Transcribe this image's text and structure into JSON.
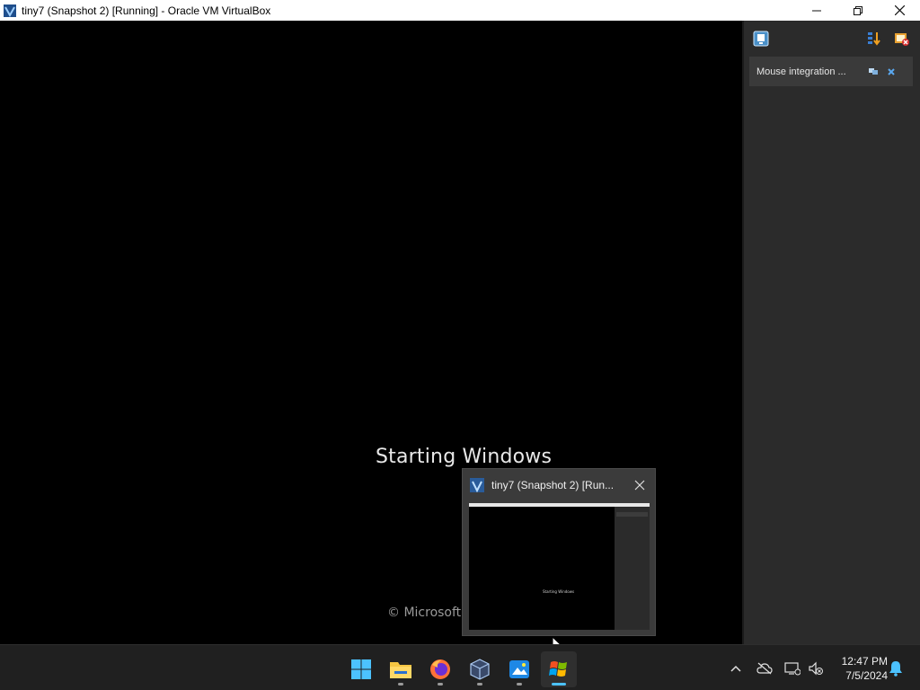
{
  "window": {
    "title": "tiny7 (Snapshot 2) [Running] - Oracle VM VirtualBox",
    "controls": [
      "minimize",
      "restore",
      "close"
    ]
  },
  "vm": {
    "boot_text": "Starting Windows",
    "copyright": "© Microsoft"
  },
  "side_panel": {
    "toolbar_icons": [
      "notification-center-icon",
      "sort-icon",
      "close-all-icon"
    ],
    "notification": {
      "text": "Mouse integration ...",
      "icons": [
        "keep-icon",
        "dismiss-icon"
      ]
    }
  },
  "taskbar_preview": {
    "title": "tiny7 (Snapshot 2) [Run...",
    "thumbnail_text": "Starting Windows"
  },
  "taskbar": {
    "apps": [
      {
        "name": "start-icon",
        "running": false
      },
      {
        "name": "file-explorer-icon",
        "running": true
      },
      {
        "name": "firefox-icon",
        "running": true
      },
      {
        "name": "virtualbox-icon",
        "running": true
      },
      {
        "name": "paint-icon",
        "running": true
      },
      {
        "name": "windows-vm-icon",
        "running": true,
        "active": true
      }
    ],
    "tray": [
      "chevron-up-icon",
      "cloud-offline-icon",
      "network-icon",
      "volume-muted-icon"
    ],
    "clock": {
      "time": "12:47 PM",
      "date": "7/5/2024"
    },
    "notification_bell": "bell-icon"
  },
  "colors": {
    "accent": "#4cc2ff",
    "panel_bg": "#2b2b2b",
    "taskbar_bg": "#202020"
  }
}
